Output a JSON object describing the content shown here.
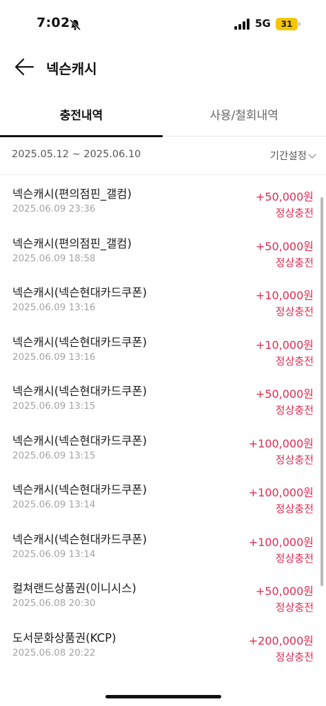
{
  "status_bar": {
    "time": "7:02",
    "network": "5G",
    "battery": "31"
  },
  "header": {
    "title": "넥슨캐시"
  },
  "tabs": [
    {
      "label": "충전내역",
      "active": true
    },
    {
      "label": "사용/철회내역",
      "active": false
    }
  ],
  "filter": {
    "date_range": "2025.05.12 ~ 2025.06.10",
    "period_label": "기간설정"
  },
  "items": [
    {
      "title": "넥슨캐시(편의점핀_갤컴)",
      "date": "2025.06.09 23:36",
      "amount": "+50,000원",
      "status": "정상충전"
    },
    {
      "title": "넥슨캐시(편의점핀_갤컴)",
      "date": "2025.06.09 18:58",
      "amount": "+50,000원",
      "status": "정상충전"
    },
    {
      "title": "넥슨캐시(넥슨현대카드쿠폰)",
      "date": "2025.06.09 13:16",
      "amount": "+10,000원",
      "status": "정상충전"
    },
    {
      "title": "넥슨캐시(넥슨현대카드쿠폰)",
      "date": "2025.06.09 13:16",
      "amount": "+10,000원",
      "status": "정상충전"
    },
    {
      "title": "넥슨캐시(넥슨현대카드쿠폰)",
      "date": "2025.06.09 13:15",
      "amount": "+50,000원",
      "status": "정상충전"
    },
    {
      "title": "넥슨캐시(넥슨현대카드쿠폰)",
      "date": "2025.06.09 13:15",
      "amount": "+100,000원",
      "status": "정상충전"
    },
    {
      "title": "넥슨캐시(넥슨현대카드쿠폰)",
      "date": "2025.06.09 13:14",
      "amount": "+100,000원",
      "status": "정상충전"
    },
    {
      "title": "넥슨캐시(넥슨현대카드쿠폰)",
      "date": "2025.06.09 13:14",
      "amount": "+100,000원",
      "status": "정상충전"
    },
    {
      "title": "컬쳐랜드상품권(이니시스)",
      "date": "2025.06.08 20:30",
      "amount": "+50,000원",
      "status": "정상충전"
    },
    {
      "title": "도서문화상품권(KCP)",
      "date": "2025.06.08 20:22",
      "amount": "+200,000원",
      "status": "정상충전"
    }
  ],
  "colors": {
    "amount": "#e6284f",
    "battery": "#f5c500"
  },
  "icons": {
    "back": "arrow-left-icon",
    "bell": "bell-slash-icon",
    "signal": "signal-bars-icon",
    "chevron": "chevron-down-icon"
  }
}
